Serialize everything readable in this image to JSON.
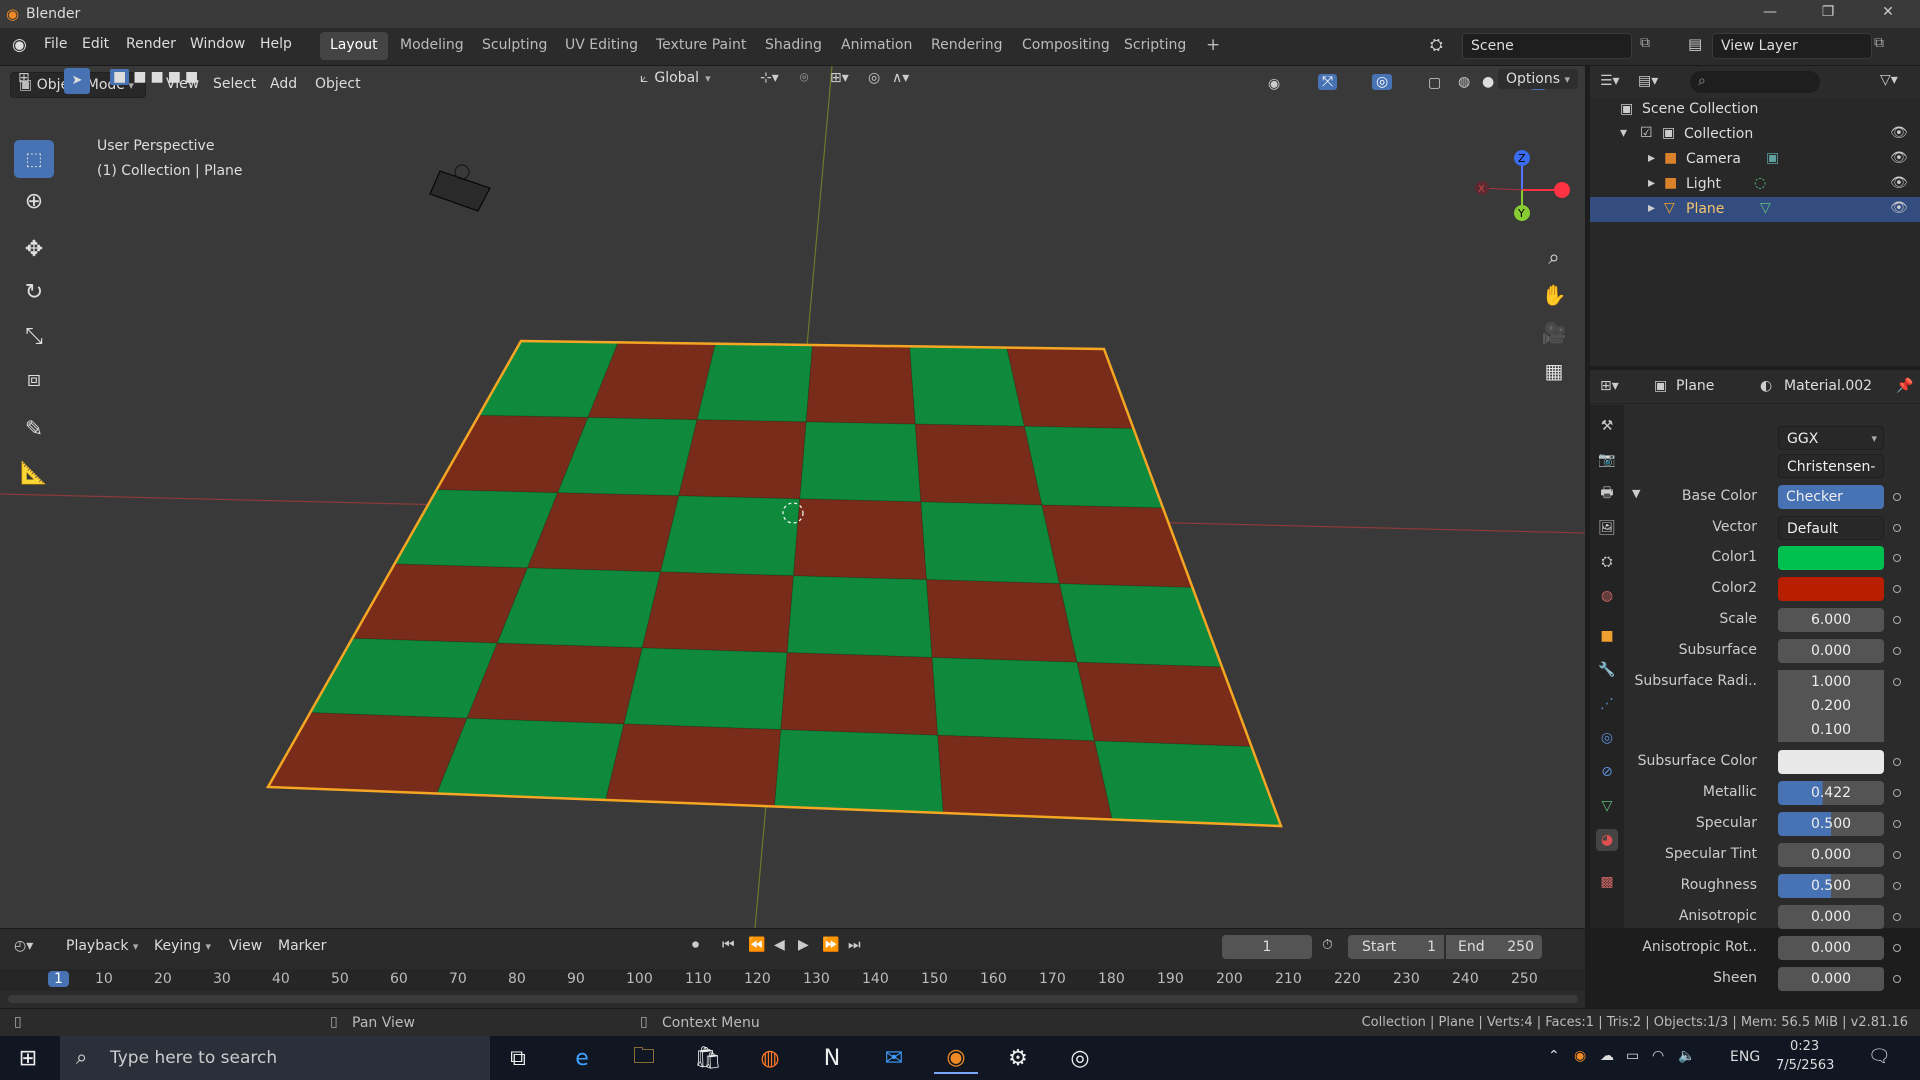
{
  "window": {
    "title": "Blender",
    "minimize": "—",
    "maximize": "❐",
    "close": "✕"
  },
  "menu": [
    "File",
    "Edit",
    "Render",
    "Window",
    "Help"
  ],
  "workspaces": [
    "Layout",
    "Modeling",
    "Sculpting",
    "UV Editing",
    "Texture Paint",
    "Shading",
    "Animation",
    "Rendering",
    "Compositing",
    "Scripting",
    "+"
  ],
  "scene": {
    "name": "Scene",
    "view_layer": "View Layer"
  },
  "viewport": {
    "mode": "Object Mode",
    "menus": [
      "View",
      "Select",
      "Add",
      "Object"
    ],
    "orientation": "Global",
    "options": "Options",
    "perspective": "User Perspective",
    "collection_info": "(1) Collection | Plane",
    "gizmo": {
      "x": "X",
      "y": "Y",
      "z": "Z"
    },
    "colors": {
      "green": "#0f8a3c",
      "red": "#7a2c1a",
      "outline": "#f5a623"
    }
  },
  "outliner": {
    "root": "Scene Collection",
    "collection": "Collection",
    "items": [
      "Camera",
      "Light",
      "Plane"
    ]
  },
  "properties": {
    "object": "Plane",
    "material": "Material.002",
    "distribution": "GGX",
    "subsurface_method": "Christensen-Bu...",
    "rows": [
      {
        "label": "Base Color",
        "value": "Checker Text..."
      },
      {
        "label": "Vector",
        "value": "Default"
      },
      {
        "label": "Color1",
        "value": ""
      },
      {
        "label": "Color2",
        "value": ""
      },
      {
        "label": "Scale",
        "value": "6.000"
      },
      {
        "label": "Subsurface",
        "value": "0.000"
      },
      {
        "label": "Subsurface Radi..",
        "value": "1.000"
      },
      {
        "label": "",
        "value": "0.200"
      },
      {
        "label": "",
        "value": "0.100"
      },
      {
        "label": "Subsurface Color",
        "value": ""
      },
      {
        "label": "Metallic",
        "value": "0.422",
        "level": 0.422
      },
      {
        "label": "Specular",
        "value": "0.500",
        "level": 0.5
      },
      {
        "label": "Specular Tint",
        "value": "0.000"
      },
      {
        "label": "Roughness",
        "value": "0.500",
        "level": 0.5
      },
      {
        "label": "Anisotropic",
        "value": "0.000"
      },
      {
        "label": "Anisotropic Rot..",
        "value": "0.000"
      },
      {
        "label": "Sheen",
        "value": "0.000"
      }
    ],
    "swatches": {
      "color1": "#00c050",
      "color2": "#b81e00",
      "subsurface": "#e8e8e8"
    }
  },
  "timeline": {
    "menus": [
      "Playback",
      "Keying",
      "View",
      "Marker"
    ],
    "current": "1",
    "start_label": "Start",
    "start": "1",
    "end_label": "End",
    "end": "250",
    "ticks": [
      "1",
      "10",
      "20",
      "30",
      "40",
      "50",
      "60",
      "70",
      "80",
      "90",
      "100",
      "110",
      "120",
      "130",
      "140",
      "150",
      "160",
      "170",
      "180",
      "190",
      "200",
      "210",
      "220",
      "230",
      "240",
      "250"
    ]
  },
  "status": {
    "pan": "Pan View",
    "context": "Context Menu",
    "stats": "Collection | Plane | Verts:4 | Faces:1 | Tris:2 | Objects:1/3 | Mem: 56.5 MiB | v2.81.16"
  },
  "taskbar": {
    "search_placeholder": "Type here to search",
    "lang": "ENG",
    "time": "0:23",
    "date": "7/5/2563"
  }
}
